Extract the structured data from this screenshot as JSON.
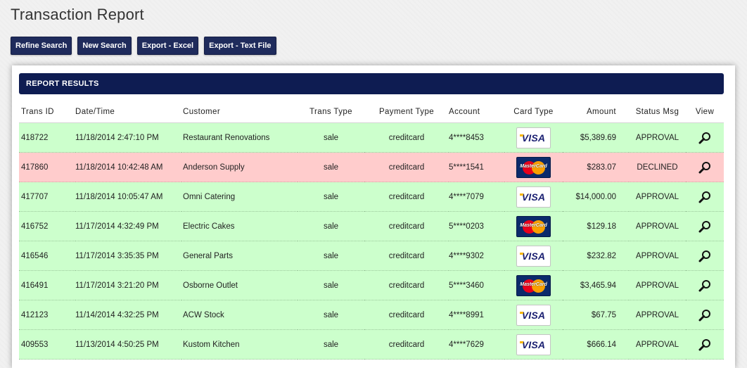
{
  "page": {
    "title": "Transaction Report"
  },
  "toolbar": {
    "refine_label": "Refine Search",
    "new_label": "New Search",
    "excel_label": "Export - Excel",
    "text_label": "Export - Text File"
  },
  "panel": {
    "header": "REPORT RESULTS"
  },
  "table": {
    "columns": [
      "Trans ID",
      "Date/Time",
      "Customer",
      "Trans Type",
      "Payment Type",
      "Account",
      "Card Type",
      "Amount",
      "Status Msg",
      "View"
    ],
    "rows": [
      {
        "id": "418722",
        "datetime": "11/18/2014 2:47:10 PM",
        "customer": "Restaurant Renovations",
        "trans_type": "sale",
        "payment_type": "creditcard",
        "account": "4****8453",
        "card": "VISA",
        "amount": "$5,389.69",
        "status": "APPROVAL"
      },
      {
        "id": "417860",
        "datetime": "11/18/2014 10:42:48 AM",
        "customer": "Anderson Supply",
        "trans_type": "sale",
        "payment_type": "creditcard",
        "account": "5****1541",
        "card": "MasterCard",
        "amount": "$283.07",
        "status": "DECLINED"
      },
      {
        "id": "417707",
        "datetime": "11/18/2014 10:05:47 AM",
        "customer": "Omni Catering",
        "trans_type": "sale",
        "payment_type": "creditcard",
        "account": "4****7079",
        "card": "VISA",
        "amount": "$14,000.00",
        "status": "APPROVAL"
      },
      {
        "id": "416752",
        "datetime": "11/17/2014 4:32:49 PM",
        "customer": "Electric Cakes",
        "trans_type": "sale",
        "payment_type": "creditcard",
        "account": "5****0203",
        "card": "MasterCard",
        "amount": "$129.18",
        "status": "APPROVAL"
      },
      {
        "id": "416546",
        "datetime": "11/17/2014 3:35:35 PM",
        "customer": "General Parts",
        "trans_type": "sale",
        "payment_type": "creditcard",
        "account": "4****9302",
        "card": "VISA",
        "amount": "$232.82",
        "status": "APPROVAL"
      },
      {
        "id": "416491",
        "datetime": "11/17/2014 3:21:20 PM",
        "customer": "Osborne Outlet",
        "trans_type": "sale",
        "payment_type": "creditcard",
        "account": "5****3460",
        "card": "MasterCard",
        "amount": "$3,465.94",
        "status": "APPROVAL"
      },
      {
        "id": "412123",
        "datetime": "11/14/2014 4:32:25 PM",
        "customer": "ACW Stock",
        "trans_type": "sale",
        "payment_type": "creditcard",
        "account": "4****8991",
        "card": "VISA",
        "amount": "$67.75",
        "status": "APPROVAL"
      },
      {
        "id": "409553",
        "datetime": "11/13/2014 4:50:25 PM",
        "customer": "Kustom Kitchen",
        "trans_type": "sale",
        "payment_type": "creditcard",
        "account": "4****7629",
        "card": "VISA",
        "amount": "$666.14",
        "status": "APPROVAL"
      }
    ]
  },
  "icons": {
    "view": "magnifier-icon",
    "visa": "visa-card-icon",
    "mastercard": "mastercard-card-icon"
  },
  "colors": {
    "header_bg": "#0e1c52",
    "button_bg": "#1f2b5c",
    "approval_row": "#ccffcc",
    "declined_row": "#ffcccc"
  }
}
